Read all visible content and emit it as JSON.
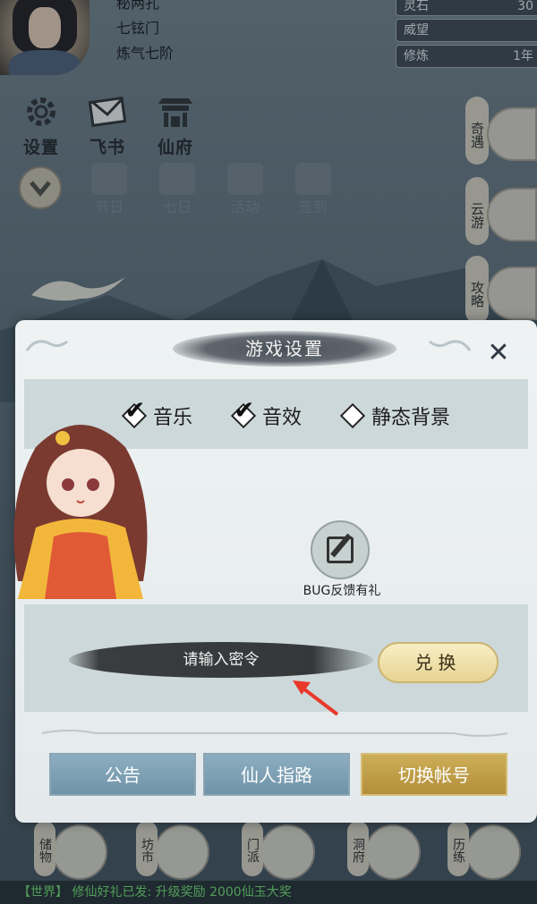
{
  "player": {
    "name": "秘两孔",
    "sect": "七铉门",
    "realm": "炼气七阶"
  },
  "stats": [
    {
      "label": "灵石",
      "value": "30"
    },
    {
      "label": "威望",
      "value": ""
    },
    {
      "label": "修炼",
      "value": "1年"
    }
  ],
  "top_menu": {
    "settings": "设置",
    "letters": "飞书",
    "mansion": "仙府"
  },
  "events": {
    "festival": "节日",
    "qixi": "七日",
    "activity": "活动",
    "checkin": "签到"
  },
  "side_buttons": {
    "adventure": "奇遇",
    "travel": "云游",
    "guide": "攻略"
  },
  "bottom_tabs": {
    "storage": "储物",
    "market": "坊市",
    "sect": "门派",
    "cave": "洞府",
    "training": "历练"
  },
  "bottom_strip_text": "【世界】 修仙好礼已发: 升级奖励 2000仙玉大奖",
  "modal": {
    "title": "游戏设置",
    "close_symbol": "✕",
    "options": {
      "music_label": "音乐",
      "music_checked": true,
      "sound_label": "音效",
      "sound_checked": true,
      "static_bg_label": "静态背景",
      "static_bg_checked": false
    },
    "bug_feedback_label": "BUG反馈有礼",
    "code_input_placeholder": "请输入密令",
    "redeem_label": "兑换",
    "announcement_label": "公告",
    "guide_label": "仙人指路",
    "switch_account_label": "切换帐号"
  },
  "colors": {
    "panel_bg": "#cdd8da",
    "blue_button": "#7b9db2",
    "gold_button": "#c2a04a",
    "redeem_button": "#efdfa6",
    "arrow": "#e8392a"
  }
}
